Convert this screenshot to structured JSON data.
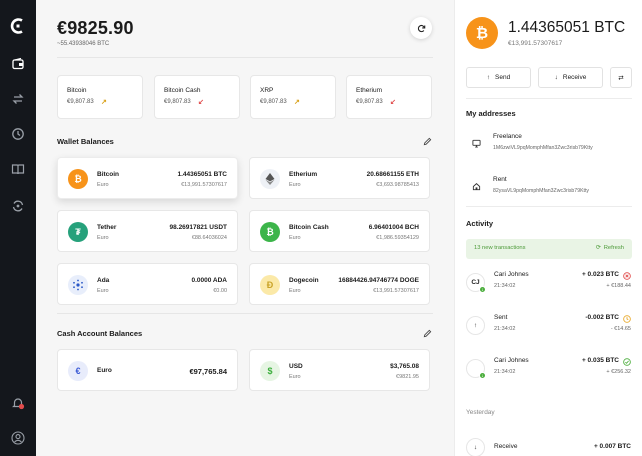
{
  "header": {
    "balance": "€9825.90",
    "balance_sub": "~55.43938046 BTC"
  },
  "tickers": [
    {
      "name": "Bitcoin",
      "price": "€9,807.83",
      "trend": "up",
      "trend_glyph": "↗",
      "trend_color": "#d9a21b"
    },
    {
      "name": "Bitcoin Cash",
      "price": "€9,807.83",
      "trend": "down",
      "trend_glyph": "↙",
      "trend_color": "#e14c4c"
    },
    {
      "name": "XRP",
      "price": "€9,807.83",
      "trend": "up",
      "trend_glyph": "↗",
      "trend_color": "#d9a21b"
    },
    {
      "name": "Etherium",
      "price": "€9,807.83",
      "trend": "down",
      "trend_glyph": "↙",
      "trend_color": "#e14c4c"
    }
  ],
  "wallet_section": {
    "title": "Wallet Balances"
  },
  "wallets": [
    {
      "name": "Bitcoin",
      "sub": "Euro",
      "value": "1.44365051 BTC",
      "fiat": "€13,991.57307617",
      "icon": "bitcoin-icon",
      "color": "#f7931a",
      "selected": true
    },
    {
      "name": "Etherium",
      "sub": "Euro",
      "value": "20.68661155 ETH",
      "fiat": "€3,693.98785413",
      "icon": "ethereum-icon",
      "color": "#eef1f6"
    },
    {
      "name": "Tether",
      "sub": "Euro",
      "value": "98.26917821 USDT",
      "fiat": "€88.64036024",
      "icon": "tether-icon",
      "color": "#26a17b"
    },
    {
      "name": "Bitcoin Cash",
      "sub": "Euro",
      "value": "6.96401004 BCH",
      "fiat": "€1,986.59354129",
      "icon": "bitcoin-cash-icon",
      "color": "#3cb54a"
    },
    {
      "name": "Ada",
      "sub": "Euro",
      "value": "0.0000 ADA",
      "fiat": "€0.00",
      "icon": "cardano-icon",
      "color": "#e8eefb"
    },
    {
      "name": "Dogecoin",
      "sub": "Euro",
      "value": "16884426.94746774 DOGE",
      "fiat": "€13,991.57307617",
      "icon": "dogecoin-icon",
      "color": "#fbe9a8"
    }
  ],
  "cash_section": {
    "title": "Cash Account Balances"
  },
  "cash": [
    {
      "name": "Euro",
      "value": "€97,765.84",
      "icon": "euro-icon",
      "color": "#e8ecfb",
      "glyph": "€",
      "glyph_color": "#3c5bd6"
    },
    {
      "name": "USD",
      "sub": "Euro",
      "value": "$3,765.08",
      "fiat": "€9821.95",
      "icon": "dollar-icon",
      "color": "#e6f5e3",
      "glyph": "$",
      "glyph_color": "#3cae3d"
    }
  ],
  "detail": {
    "amount": "1.44365051 BTC",
    "fiat": "€13,991.57307617",
    "send_label": "Send",
    "receive_label": "Receive"
  },
  "addresses": {
    "title": "My addresses",
    "items": [
      {
        "name": "Freelance",
        "address": "1M6zwiVL9pqMomphMfan3Zwc3risb79Ktty",
        "icon": "monitor-icon"
      },
      {
        "name": "Rent",
        "address": "82ysaVL9pqMomphMfan3Zwc3risb79Ktty",
        "icon": "home-icon"
      }
    ]
  },
  "activity": {
    "title": "Activity",
    "notice": "13 new transactions",
    "refresh": "Refresh",
    "items": [
      {
        "avatar": "CJ",
        "name": "Cari Johnes",
        "time": "21:34:02",
        "amount": "+ 0.023 BTC",
        "fiat": "+ €188.44",
        "status": "failed",
        "status_color": "#e14c4c"
      },
      {
        "avatar": "↑",
        "name": "Sent",
        "time": "21:34:02",
        "amount": "-0.002 BTC",
        "fiat": "- €14.65",
        "status": "pending",
        "status_color": "#e8a92a"
      },
      {
        "avatar": "",
        "name": "Cari Johnes",
        "time": "21:34:02",
        "amount": "+ 0.035 BTC",
        "fiat": "+ €256.32",
        "status": "success",
        "status_color": "#4cae3d"
      }
    ],
    "yesterday_label": "Yesterday",
    "yesterday_items": [
      {
        "name": "Receive",
        "amount": "+ 0.007 BTC"
      }
    ]
  }
}
